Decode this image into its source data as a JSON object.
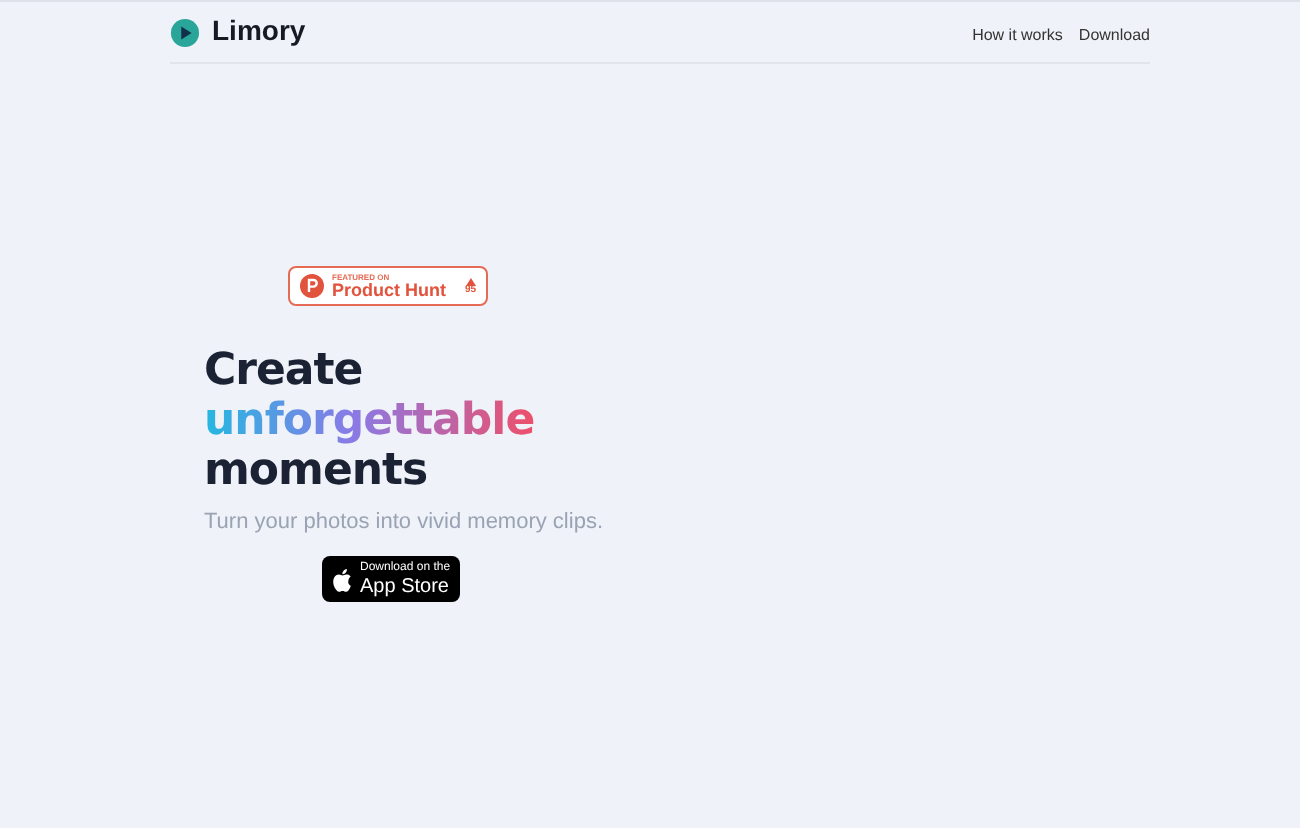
{
  "header": {
    "brand": "Limory",
    "nav": [
      "How it works",
      "Download"
    ]
  },
  "hero": {
    "badge": {
      "kicker": "FEATURED ON",
      "name": "Product Hunt",
      "votes": "95"
    },
    "title": [
      {
        "text": "Create",
        "kind": "plain"
      },
      {
        "text": "unforgettable",
        "kind": "gradient"
      },
      {
        "text": "moments",
        "kind": "plain"
      }
    ],
    "subtitle": "Turn your photos into vivid memory clips.",
    "store_button": {
      "small": "Download on the",
      "large": "App Store"
    }
  }
}
